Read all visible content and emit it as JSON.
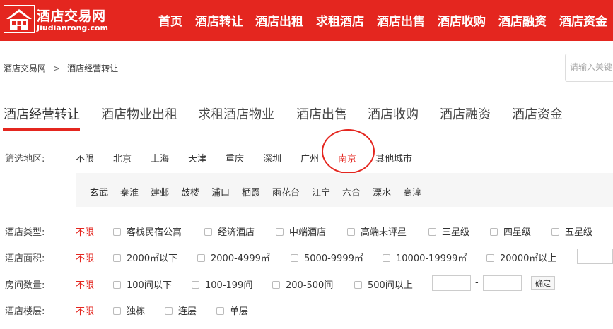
{
  "colors": {
    "brand": "#e4261f",
    "text": "#333333",
    "active_filter": "#e4261f"
  },
  "logo": {
    "icon": "house-logo-icon",
    "title": "酒店交易网",
    "subtitle": "Jiudianrong.com"
  },
  "nav": [
    "首页",
    "酒店转让",
    "酒店出租",
    "求租酒店",
    "酒店出售",
    "酒店收购",
    "酒店融资",
    "酒店资金"
  ],
  "breadcrumb": {
    "home": "酒店交易网",
    "separator": ">",
    "current": "酒店经营转让"
  },
  "search": {
    "placeholder": "请输入关键"
  },
  "tabs": [
    "酒店经营转让",
    "酒店物业出租",
    "求租酒店物业",
    "酒店出售",
    "酒店收购",
    "酒店融资",
    "酒店资金"
  ],
  "active_tab": "酒店经营转让",
  "region": {
    "label": "筛选地区:",
    "cities": [
      "不限",
      "北京",
      "上海",
      "天津",
      "重庆",
      "深圳",
      "广州",
      "南京",
      "其他城市"
    ],
    "selected": "南京",
    "districts": [
      "玄武",
      "秦淮",
      "建邺",
      "鼓楼",
      "浦口",
      "栖霞",
      "雨花台",
      "江宁",
      "六合",
      "溧水",
      "高淳"
    ]
  },
  "filters": {
    "hotel_type": {
      "label": "酒店类型:",
      "all": "不限",
      "options": [
        "客栈民宿公寓",
        "经济酒店",
        "中端酒店",
        "高端未评星",
        "三星级",
        "四星级",
        "五星级"
      ]
    },
    "area": {
      "label": "酒店面积:",
      "all": "不限",
      "options": [
        "2000㎡以下",
        "2000-4999㎡",
        "5000-9999㎡",
        "10000-19999㎡",
        "20000㎡以上"
      ]
    },
    "rooms": {
      "label": "房间数量:",
      "all": "不限",
      "options": [
        "100间以下",
        "100-199间",
        "200-500间",
        "500间以上"
      ],
      "range_separator": "-",
      "confirm": "确定"
    },
    "floors": {
      "label": "酒店楼层:",
      "all": "不限",
      "options": [
        "独栋",
        "连层",
        "单层"
      ]
    }
  }
}
